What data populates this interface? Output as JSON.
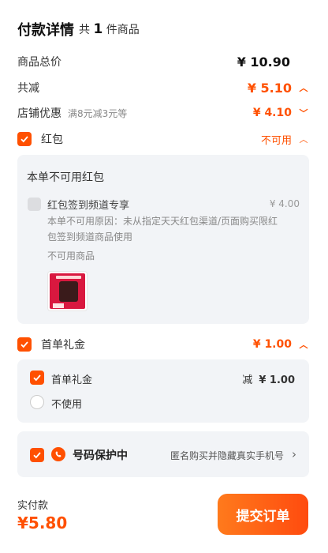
{
  "header": {
    "title": "付款详情",
    "count_prefix": "共",
    "count": "1",
    "count_suffix": "件商品"
  },
  "summary": {
    "total_label": "商品总价",
    "total_value": "¥ 10.90",
    "discount_label": "共减",
    "discount_value": "¥ 5.10",
    "shop_label": "店铺优惠",
    "shop_sub": "满8元减3元等",
    "shop_value": "¥ 4.10"
  },
  "redpacket": {
    "label": "红包",
    "status": "不可用",
    "panel_title": "本单不可用红包",
    "item_name": "红包签到频道专享",
    "item_value": "¥ 4.00",
    "reason": "本单不可用原因：未从指定天天红包渠道/页面购买限红包签到频道商品使用",
    "unusable": "不可用商品"
  },
  "gift": {
    "label": "首单礼金",
    "value": "¥ 1.00",
    "option1": "首单礼金",
    "option1_prefix": "减",
    "option1_value": "¥ 1.00",
    "option2": "不使用"
  },
  "privacy": {
    "label": "号码保护中",
    "desc": "匿名购买并隐藏真实手机号"
  },
  "footer": {
    "paid_label": "实付款",
    "paid_value": "¥5.80",
    "submit": "提交订单"
  },
  "colors": {
    "accent": "#ff5000",
    "panel": "#f2f4f7"
  }
}
